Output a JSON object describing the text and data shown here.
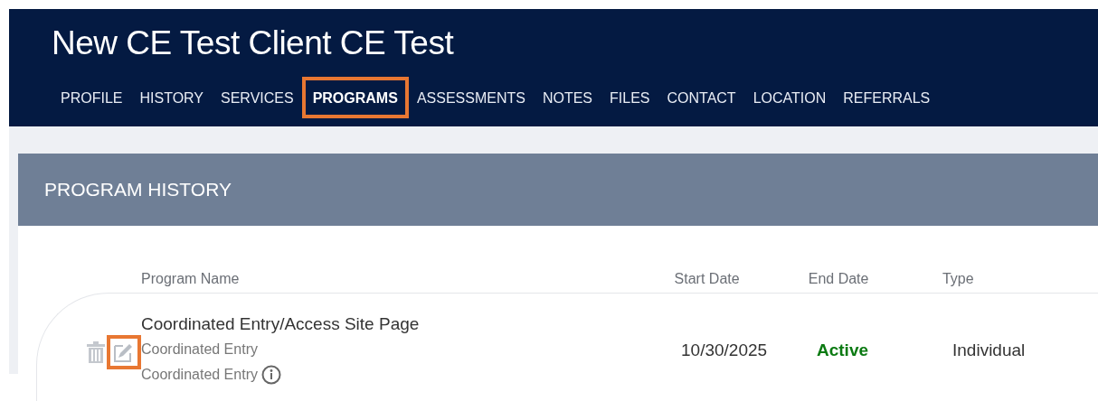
{
  "header": {
    "title": "New CE Test Client CE Test"
  },
  "tabs": [
    {
      "label": "PROFILE",
      "selected": false,
      "highlighted": false
    },
    {
      "label": "HISTORY",
      "selected": false,
      "highlighted": false
    },
    {
      "label": "SERVICES",
      "selected": false,
      "highlighted": false
    },
    {
      "label": "PROGRAMS",
      "selected": true,
      "highlighted": true
    },
    {
      "label": "ASSESSMENTS",
      "selected": false,
      "highlighted": false
    },
    {
      "label": "NOTES",
      "selected": false,
      "highlighted": false
    },
    {
      "label": "FILES",
      "selected": false,
      "highlighted": false
    },
    {
      "label": "CONTACT",
      "selected": false,
      "highlighted": false
    },
    {
      "label": "LOCATION",
      "selected": false,
      "highlighted": false
    },
    {
      "label": "REFERRALS",
      "selected": false,
      "highlighted": false
    }
  ],
  "panel": {
    "title": "PROGRAM HISTORY"
  },
  "table": {
    "columns": [
      "Program Name",
      "Start Date",
      "End Date",
      "Type"
    ],
    "rows": [
      {
        "name": "Coordinated Entry/Access Site Page",
        "subtitle_1": "Coordinated Entry",
        "subtitle_2": "Coordinated Entry",
        "edit_highlighted": true,
        "start_date": "10/30/2025",
        "end_date": {
          "text": "Active",
          "kind": "active"
        },
        "type": "Individual"
      }
    ]
  }
}
